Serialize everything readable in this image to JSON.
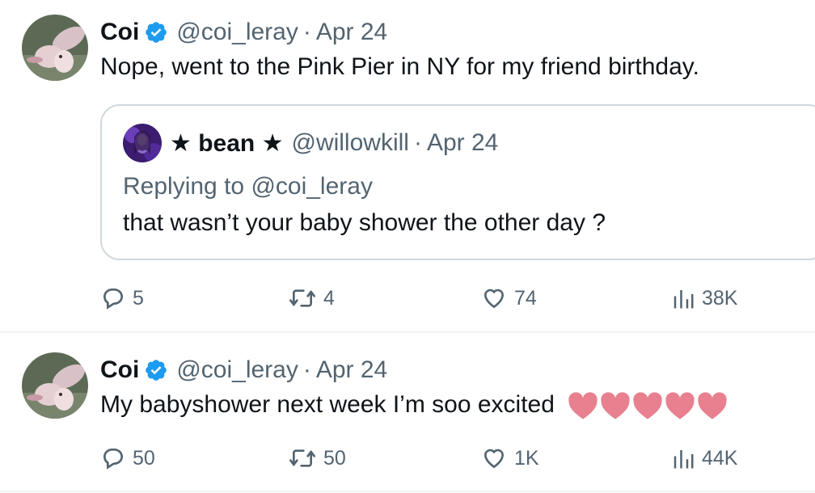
{
  "tweets": [
    {
      "author": {
        "name": "Coi",
        "handle": "@coi_leray",
        "avatar_icon": "pink-creature-avatar",
        "verified": true
      },
      "date": "Apr 24",
      "text": "Nope, went to the Pink Pier in NY for my friend birthday.",
      "quote": {
        "author": {
          "name": "★ bean ★",
          "handle": "@willowkill",
          "avatar_icon": "purple-portrait-avatar"
        },
        "date": "Apr 24",
        "replying_prefix": "Replying to",
        "replying_to": "@coi_leray",
        "text": "that wasn’t your baby shower the other day ?"
      },
      "stats": {
        "replies": "5",
        "retweets": "4",
        "likes": "74",
        "views": "38K"
      }
    },
    {
      "author": {
        "name": "Coi",
        "handle": "@coi_leray",
        "avatar_icon": "pink-creature-avatar",
        "verified": true
      },
      "date": "Apr 24",
      "text": "My babyshower next week I’m soo excited",
      "emoji": [
        "pink-heart",
        "pink-heart",
        "pink-heart",
        "pink-heart",
        "pink-heart"
      ],
      "stats": {
        "replies": "50",
        "retweets": "50",
        "likes": "1K",
        "views": "44K"
      }
    }
  ],
  "separator": "·",
  "colors": {
    "text": "#0f1419",
    "secondary": "#536471",
    "verified": "#1d9bf0",
    "border": "#cfd9de",
    "heart_emoji": "#e8808f"
  }
}
